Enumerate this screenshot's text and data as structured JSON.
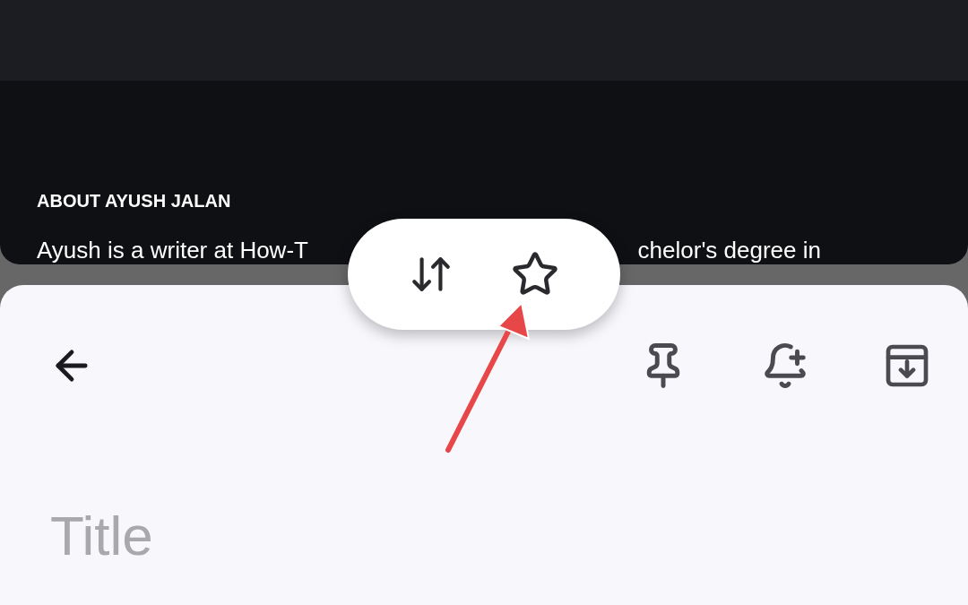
{
  "top_panel": {
    "heading": "ABOUT AYUSH JALAN",
    "text_parts": [
      "Ayush is a writer at How-T",
      "chelor's degree in"
    ]
  },
  "note": {
    "title": {
      "placeholder": "Title"
    }
  }
}
